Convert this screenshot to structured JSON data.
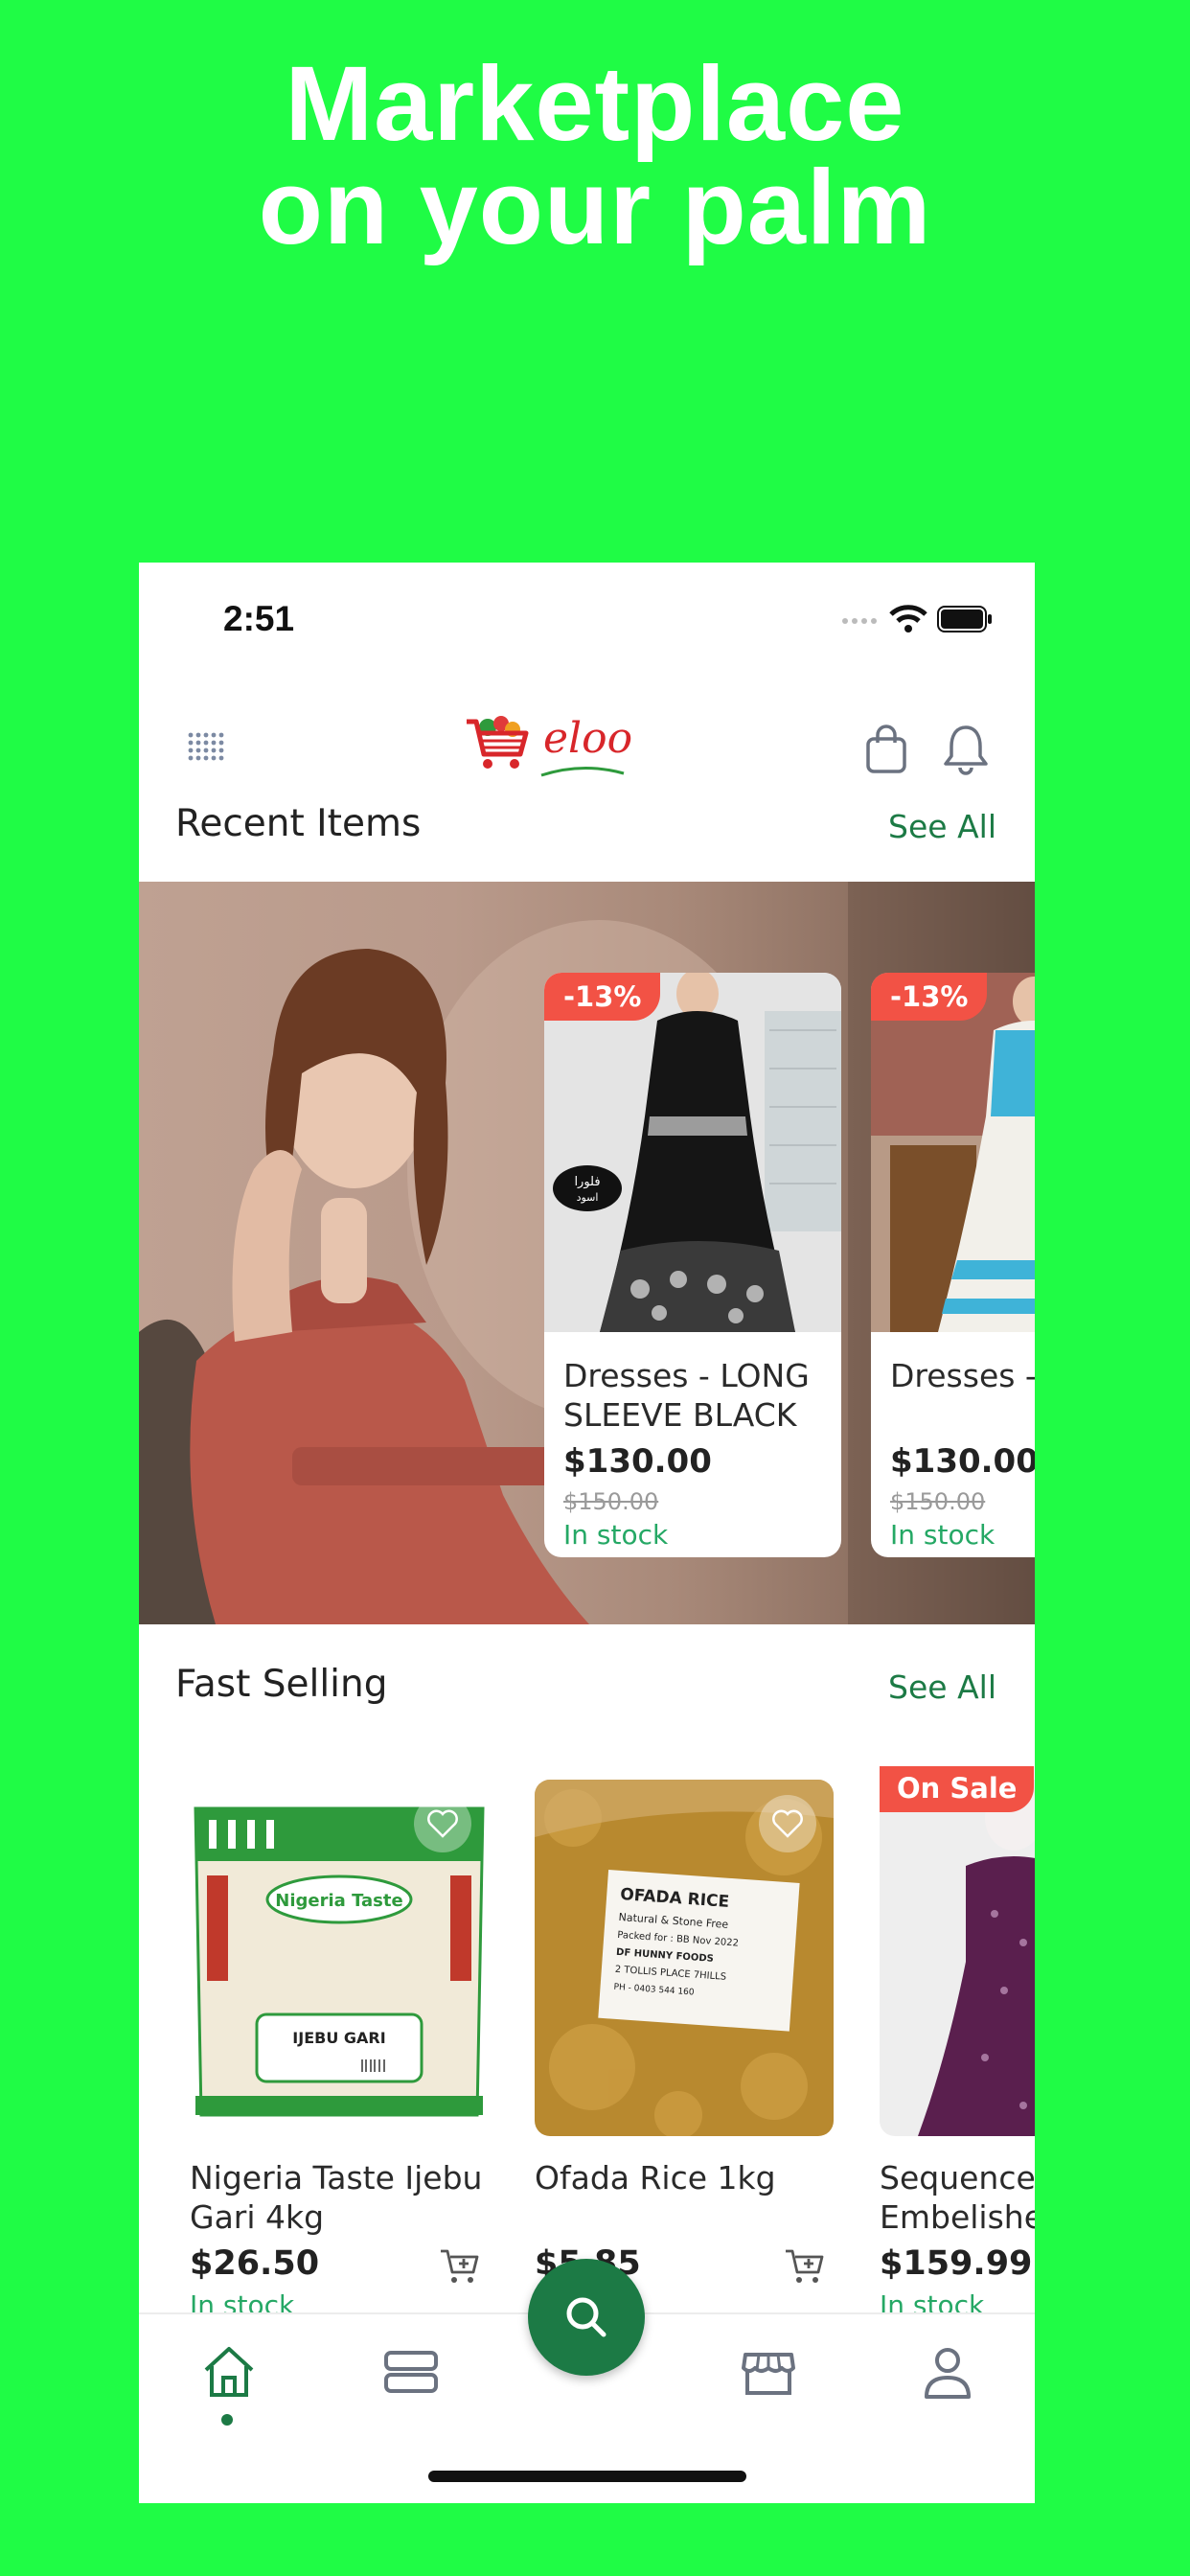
{
  "headline": {
    "line1": "Marketplace",
    "line2": "on your palm"
  },
  "status_bar": {
    "time": "2:51"
  },
  "header": {
    "brand": "eloo"
  },
  "recent": {
    "title": "Recent Items",
    "see_all": "See All",
    "cards": [
      {
        "discount": "-13%",
        "name": "Dresses - LONG SLEEVE BLACK",
        "price": "$130.00",
        "old_price": "$150.00",
        "stock": "In stock"
      },
      {
        "discount": "-13%",
        "name": "Dresses -",
        "price": "$130.00",
        "old_price": "$150.00",
        "stock": "In stock"
      }
    ]
  },
  "fast_selling": {
    "title": "Fast Selling",
    "see_all": "See All",
    "items": [
      {
        "name": "Nigeria Taste Ijebu Gari 4kg",
        "price": "$26.50",
        "stock": "In stock",
        "pack_brand": "Nigeria Taste",
        "pack_label": "IJEBU GARI"
      },
      {
        "name": "Ofada Rice 1kg",
        "price": "$5.85",
        "stock": "",
        "pack_lines": [
          "OFADA RICE",
          "Natural & Stone Free",
          "Packed for : BB Nov 2022",
          "DF HUNNY FOODS",
          "2 TOLLIS PLACE 7HILLS",
          "PH - 0403 544 160"
        ]
      },
      {
        "badge": "On Sale",
        "name": "Sequence Embelished",
        "price": "$159.99",
        "stock": "In stock"
      }
    ]
  },
  "tabs": [
    "home",
    "categories",
    "search",
    "stores",
    "profile"
  ],
  "colors": {
    "background": "#1ffc45",
    "accent": "#1c7a45",
    "sale": "#f25245",
    "stock": "#25a865"
  }
}
